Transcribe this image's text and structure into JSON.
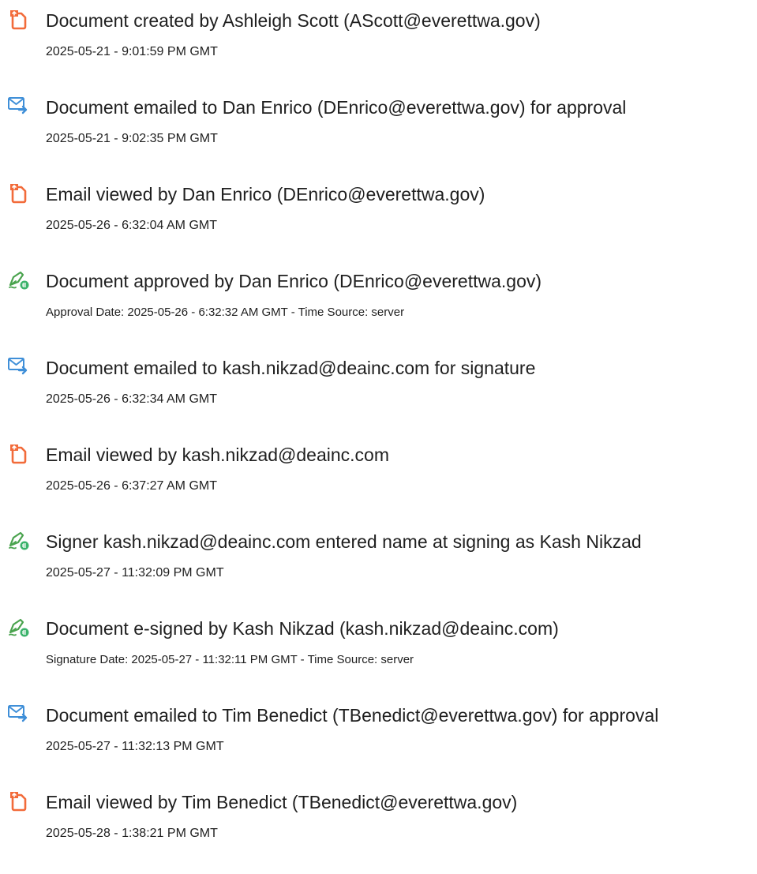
{
  "colors": {
    "doc_icon": "#f26b3a",
    "email_icon": "#3f8fd8",
    "sign_icon": "#4aa34e",
    "sign_badge": "#3bb36b"
  },
  "events": [
    {
      "icon": "document-icon",
      "title": "Document created by Ashleigh Scott (AScott@everettwa.gov)",
      "meta": "2025-05-21 - 9:01:59 PM GMT"
    },
    {
      "icon": "email-icon",
      "title": "Document emailed to Dan Enrico (DEnrico@everettwa.gov) for approval",
      "meta": "2025-05-21 - 9:02:35 PM GMT"
    },
    {
      "icon": "document-icon",
      "title": "Email viewed by Dan Enrico (DEnrico@everettwa.gov)",
      "meta": "2025-05-26 - 6:32:04 AM GMT"
    },
    {
      "icon": "signature-icon",
      "title": "Document approved by Dan Enrico (DEnrico@everettwa.gov)",
      "meta": "Approval Date: 2025-05-26 - 6:32:32 AM GMT - Time Source: server"
    },
    {
      "icon": "email-icon",
      "title": "Document emailed to kash.nikzad@deainc.com for signature",
      "meta": "2025-05-26 - 6:32:34 AM GMT"
    },
    {
      "icon": "document-icon",
      "title": "Email viewed by kash.nikzad@deainc.com",
      "meta": "2025-05-26 - 6:37:27 AM GMT"
    },
    {
      "icon": "signature-icon",
      "title": "Signer kash.nikzad@deainc.com entered name at signing as Kash Nikzad",
      "meta": "2025-05-27 - 11:32:09 PM GMT"
    },
    {
      "icon": "signature-icon",
      "title": "Document e-signed by Kash Nikzad (kash.nikzad@deainc.com)",
      "meta": "Signature Date: 2025-05-27 - 11:32:11 PM GMT - Time Source: server"
    },
    {
      "icon": "email-icon",
      "title": "Document emailed to Tim Benedict (TBenedict@everettwa.gov) for approval",
      "meta": "2025-05-27 - 11:32:13 PM GMT"
    },
    {
      "icon": "document-icon",
      "title": "Email viewed by Tim Benedict (TBenedict@everettwa.gov)",
      "meta": "2025-05-28 - 1:38:21 PM GMT"
    }
  ]
}
